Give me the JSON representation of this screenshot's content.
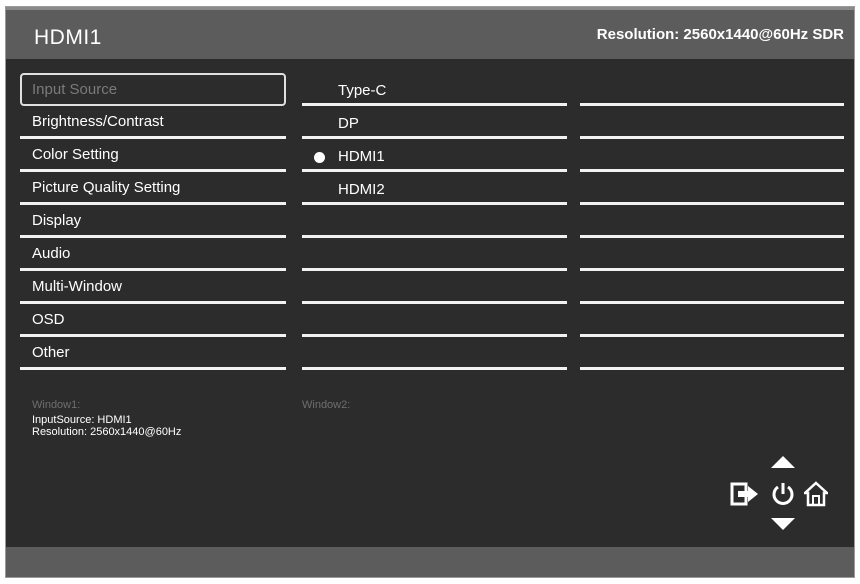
{
  "header": {
    "title": "HDMI1",
    "resolution": "Resolution: 2560x1440@60Hz SDR"
  },
  "menu": {
    "items": [
      {
        "label": "Input Source"
      },
      {
        "label": "Brightness/Contrast"
      },
      {
        "label": "Color Setting"
      },
      {
        "label": "Picture Quality Setting"
      },
      {
        "label": "Display"
      },
      {
        "label": "Audio"
      },
      {
        "label": "Multi-Window"
      },
      {
        "label": "OSD"
      },
      {
        "label": "Other"
      }
    ]
  },
  "options": {
    "items": [
      {
        "label": "Type-C"
      },
      {
        "label": "DP"
      },
      {
        "label": "HDMI1"
      },
      {
        "label": "HDMI2"
      }
    ]
  },
  "window1": {
    "title": "Window1:",
    "input_source": "InputSource: HDMI1",
    "resolution": "Resolution: 2560x1440@60Hz"
  },
  "window2": {
    "title": "Window2:"
  },
  "colors": {
    "panel": "#2c2c2c",
    "header": "#5c5c5c",
    "text": "#ffffff",
    "dim_text": "#6e6e6e"
  }
}
